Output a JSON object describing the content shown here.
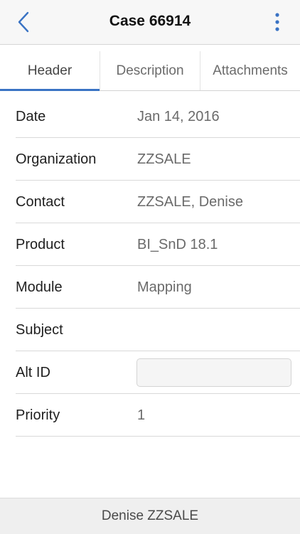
{
  "nav": {
    "title": "Case 66914",
    "back_icon": "chevron-left-icon",
    "more_icon": "vertical-ellipsis-icon",
    "accent_color": "#3a73c4"
  },
  "tabs": [
    {
      "label": "Header",
      "active": true
    },
    {
      "label": "Description",
      "active": false
    },
    {
      "label": "Attachments",
      "active": false
    }
  ],
  "fields": {
    "date": {
      "label": "Date",
      "value": "Jan 14, 2016"
    },
    "organization": {
      "label": "Organization",
      "value": "ZZSALE"
    },
    "contact": {
      "label": "Contact",
      "value": "ZZSALE, Denise"
    },
    "product": {
      "label": "Product",
      "value": "BI_SnD 18.1"
    },
    "module": {
      "label": "Module",
      "value": "Mapping"
    },
    "subject": {
      "label": "Subject",
      "value": ""
    },
    "alt_id": {
      "label": "Alt ID",
      "value": ""
    },
    "priority": {
      "label": "Priority",
      "value": "1"
    }
  },
  "footer": {
    "user": "Denise ZZSALE"
  }
}
